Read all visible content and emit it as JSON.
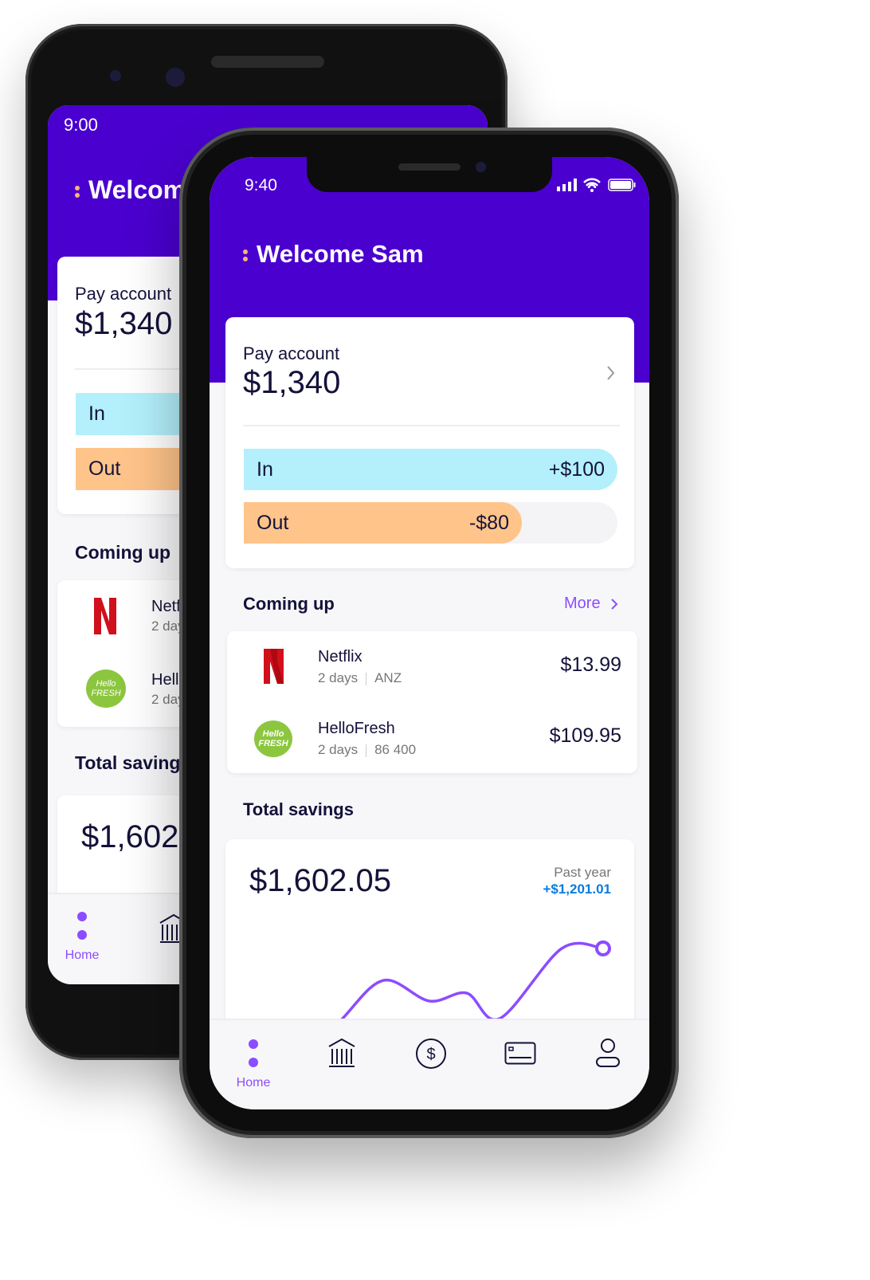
{
  "colors": {
    "brand": "#4a00cf",
    "in": "#b3f0fb",
    "out": "#ffc48a",
    "accent": "#8c4cff",
    "positive": "#0a7be0",
    "text": "#14123a"
  },
  "back_phone": {
    "status_time": "9:00",
    "welcome": "Welcome Sam",
    "pay_account": {
      "label": "Pay account",
      "balance": "$1,340",
      "in_label": "In",
      "out_label": "Out"
    },
    "coming_up_title": "Coming up",
    "items": [
      {
        "name": "Netflix",
        "sub": "2 days"
      },
      {
        "name": "HelloFresh",
        "sub": "2 days"
      }
    ],
    "savings_title": "Total savings",
    "savings_amount": "$1,602.05",
    "nav_home": "Home"
  },
  "front_phone": {
    "status_time": "9:40",
    "status_icons": [
      "signal-icon",
      "wifi-icon",
      "battery-icon"
    ],
    "welcome": "Welcome Sam",
    "pay_account": {
      "label": "Pay account",
      "balance": "$1,340",
      "in_label": "In",
      "in_value": "+$100",
      "out_label": "Out",
      "out_value": "-$80",
      "in_fraction": 1.0,
      "out_fraction": 0.8
    },
    "coming_up": {
      "title": "Coming up",
      "more": "More",
      "items": [
        {
          "icon": "netflix-logo",
          "name": "Netflix",
          "when": "2 days",
          "account": "ANZ",
          "amount": "$13.99"
        },
        {
          "icon": "hellofresh-logo",
          "logo_text": "Hello FRESH",
          "name": "HelloFresh",
          "when": "2 days",
          "account": "86 400",
          "amount": "$109.95"
        }
      ]
    },
    "savings": {
      "title": "Total savings",
      "amount": "$1,602.05",
      "period": "Past year",
      "change": "+$1,201.01"
    },
    "nav": [
      {
        "icon": "home-dots-icon",
        "label": "Home",
        "active": true
      },
      {
        "icon": "bank-icon"
      },
      {
        "icon": "dollar-circle-icon"
      },
      {
        "icon": "card-icon"
      },
      {
        "icon": "profile-icon"
      }
    ]
  },
  "chart_data": {
    "type": "line",
    "x": [
      0,
      1,
      2,
      3.1,
      4,
      4.8,
      6.3,
      7.3
    ],
    "values": [
      -60,
      0,
      48,
      22,
      32,
      0,
      88,
      88
    ],
    "title": "",
    "xlabel": "",
    "ylabel": "",
    "grid": false,
    "end_marker": true
  }
}
